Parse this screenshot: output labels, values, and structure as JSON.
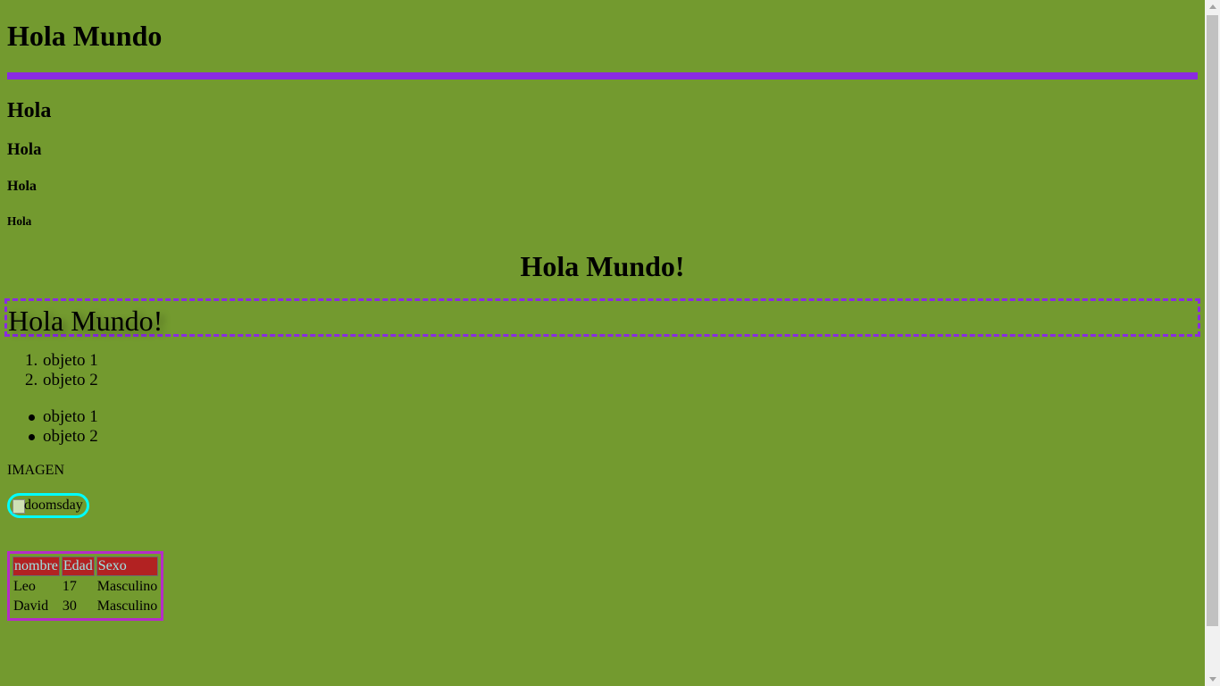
{
  "page": {
    "title": "Hola Mundo",
    "headings": [
      "Hola",
      "Hola",
      "Hola",
      "Hola"
    ],
    "centered_heading": "Hola Mundo!",
    "boxed_heading": "Hola Mundo!",
    "ordered_list": [
      "objeto 1",
      "objeto 2"
    ],
    "ordered_markers": [
      "1.",
      "2."
    ],
    "unordered_list": [
      "objeto 1",
      "objeto 2"
    ],
    "image_label": "IMAGEN",
    "image_alt": "doomsday",
    "table": {
      "headers": [
        "nombre",
        "Edad",
        "Sexo"
      ],
      "rows": [
        [
          "Leo",
          "17",
          "Masculino"
        ],
        [
          "David",
          "30",
          "Masculino"
        ]
      ]
    }
  },
  "colors": {
    "background": "#739a2f",
    "accent_bar": "#8a2be2",
    "image_border": "#00ffff",
    "table_border": "#b52dc7",
    "table_header_bg": "#b22222",
    "table_header_text": "#9ee5e5"
  },
  "icons": {
    "broken_image": "broken-image-icon"
  }
}
